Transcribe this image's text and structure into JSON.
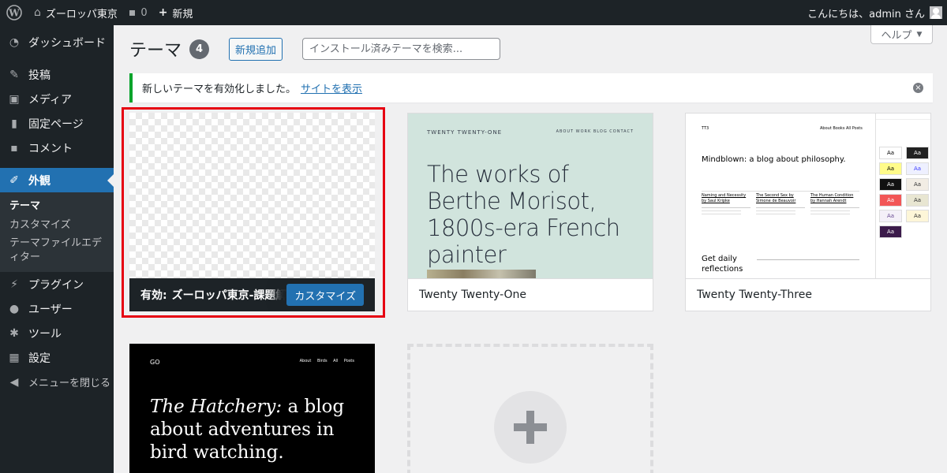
{
  "adminbar": {
    "site_name": "ズーロッパ東京",
    "comments_count": "0",
    "new_label": "新規",
    "greeting": "こんにちは、admin さん"
  },
  "sidebar": {
    "items": [
      {
        "icon": "dashboard-icon",
        "label": "ダッシュボード"
      },
      {
        "icon": "pin-icon",
        "label": "投稿"
      },
      {
        "icon": "media-icon",
        "label": "メディア"
      },
      {
        "icon": "page-icon",
        "label": "固定ページ"
      },
      {
        "icon": "comment-icon",
        "label": "コメント"
      },
      {
        "icon": "appearance-icon",
        "label": "外観"
      },
      {
        "icon": "plugin-icon",
        "label": "プラグイン"
      },
      {
        "icon": "user-icon",
        "label": "ユーザー"
      },
      {
        "icon": "tool-icon",
        "label": "ツール"
      },
      {
        "icon": "settings-icon",
        "label": "設定"
      },
      {
        "icon": "collapse-icon",
        "label": "メニューを閉じる"
      }
    ],
    "submenu": [
      "テーマ",
      "カスタマイズ",
      "テーマファイルエディター"
    ]
  },
  "header": {
    "title": "テーマ",
    "count": "4",
    "add_new": "新規追加",
    "search_placeholder": "インストール済みテーマを検索...",
    "help": "ヘルプ"
  },
  "notice": {
    "text": "新しいテーマを有効化しました。",
    "link": "サイトを表示"
  },
  "themes": {
    "active": {
      "label": "有効:",
      "name": "ズーロッパ東京-課題解説",
      "customize": "カスタマイズ"
    },
    "tt1": {
      "name": "Twenty Twenty-One",
      "site": "TWENTY TWENTY-ONE",
      "nav": "ABOUT   WORK   BLOG   CONTACT",
      "headline": "The works of Berthe Morisot, 1800s-era French painter"
    },
    "tt3": {
      "name": "Twenty Twenty-Three",
      "site": "TT3",
      "nav": "About   Books   All Posts",
      "headline": "Mindblown: a blog about philosophy.",
      "posts": [
        "Naming and Necessity by Saul Kripke",
        "The Second Sex by Simone de Beauvoir",
        "The Human Condition by Hannah Arendt"
      ],
      "daily": "Get daily reflections",
      "swatch": "Aa"
    },
    "tt2": {
      "logo": "GO",
      "nav": "About  Birds  All Posts",
      "headline_em": "The Hatchery:",
      "headline_rest": " a blog about adventures in bird watching."
    }
  },
  "colors": {
    "accent": "#2271b1",
    "highlight": "#e60012",
    "success": "#00a32a",
    "dark": "#1d2327"
  }
}
